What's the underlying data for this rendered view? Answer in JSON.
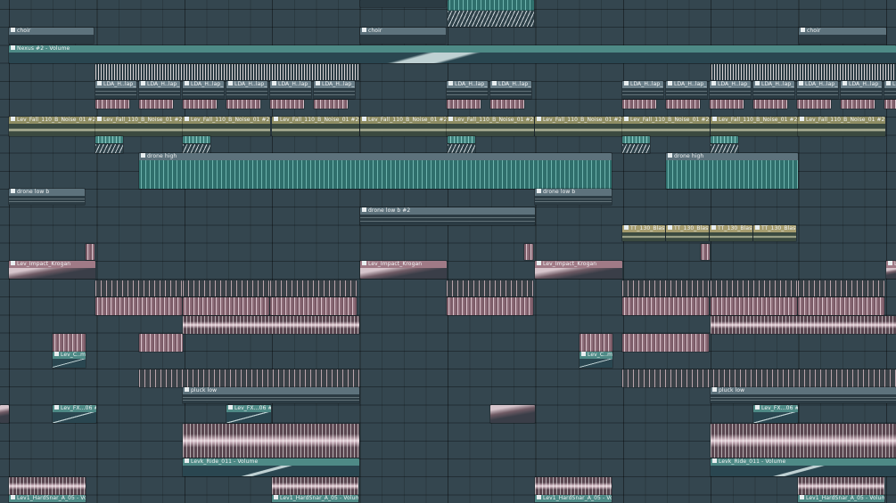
{
  "playlist": {
    "choir": "choir",
    "nexus_automation": "Nexus #2 - Volume",
    "lda": "LDA_H..lap_1",
    "lev_fall": "Lev_Fall_110_B_Noise_01 #2",
    "drone_high": "drone high",
    "drone_low": "drone low b",
    "drone_low_2": "drone low b #2",
    "tt_blasted": "TT_130_Blasted",
    "impact": "Lev_Impact_Krogan",
    "lev_c": "Lev_C..me",
    "lev_fx": "Lev_FX...06 #2",
    "pluck_low": "pluck low",
    "ride": "Levk_Ride_011 - Volume",
    "hardsnar": "Lev1_HardSnar_A_05 - Volume"
  },
  "colors": {
    "background": "#34464f",
    "automation_header": "#4e8a86",
    "pattern_header": "#5d727c",
    "audio_header": "#8f8d63",
    "impact_header": "#a07a86"
  },
  "icons": [
    "pattern-icon",
    "automation-icon",
    "audio-clip-icon"
  ]
}
